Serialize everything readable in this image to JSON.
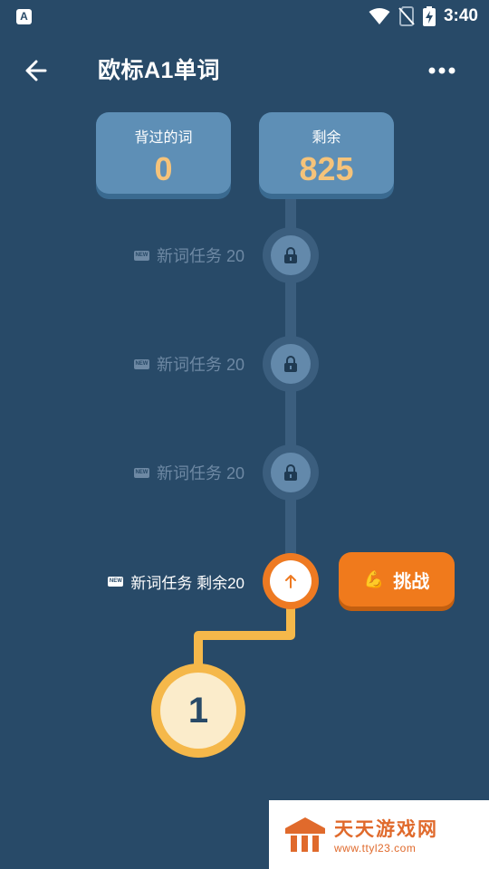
{
  "status_bar": {
    "app_icon_letter": "A",
    "time": "3:40"
  },
  "header": {
    "title": "欧标A1单词"
  },
  "stats": [
    {
      "label": "背过的词",
      "value": "0"
    },
    {
      "label": "剩余",
      "value": "825"
    }
  ],
  "tasks": [
    {
      "badge": "NEW",
      "label": "新词任务 20",
      "state": "locked"
    },
    {
      "badge": "NEW",
      "label": "新词任务 20",
      "state": "locked"
    },
    {
      "badge": "NEW",
      "label": "新词任务 20",
      "state": "locked"
    },
    {
      "badge": "NEW",
      "label": "新词任务 剩余20",
      "state": "active"
    }
  ],
  "challenge_button": {
    "emoji": "💪",
    "label": "挑战"
  },
  "level": {
    "number": "1"
  },
  "watermark": {
    "title": "天天游戏网",
    "url": "www.ttyl23.com"
  },
  "colors": {
    "background": "#284a68",
    "card": "#5e8fb6",
    "stat_value": "#f5c37a",
    "accent_orange": "#f07a1c",
    "path_gold": "#f5b84a"
  }
}
